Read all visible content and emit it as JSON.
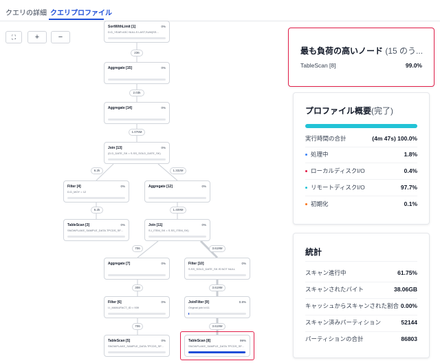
{
  "tabs": [
    {
      "label": "クエリの詳細",
      "active": false
    },
    {
      "label": "クエリプロファイル",
      "active": true
    }
  ],
  "toolbar": {
    "fit_icon": "⛶",
    "zoom_in_icon": "+",
    "zoom_out_icon": "−"
  },
  "graph": {
    "nodes": [
      {
        "title": "SortWithLimit [1]",
        "pct": "0%",
        "detail": "D.D_YEAR ASC NULLS LAST,SUM(SS...",
        "progress": 0
      },
      {
        "title": "Aggregate [15]",
        "pct": "0%",
        "detail": "",
        "progress": 0
      },
      {
        "title": "Aggregate [14]",
        "pct": "0%",
        "detail": "",
        "progress": 0
      },
      {
        "title": "Join [13]",
        "pct": "0%",
        "detail": "(D.D_DATE_SK = S.SS_SOLD_DATE_SK)",
        "progress": 0
      },
      {
        "title": "Filter [4]",
        "pct": "0%",
        "detail": "D.D_MOY = 12",
        "progress": 0
      },
      {
        "title": "Aggregate [12]",
        "pct": "0%",
        "detail": "",
        "progress": 0
      },
      {
        "title": "TableScan [3]",
        "pct": "0%",
        "detail": "SNOWFLAKE_SAMPLE_DATA.TPCDS_SF...",
        "progress": 0
      },
      {
        "title": "Join [11]",
        "pct": "0%",
        "detail": "S.I_ITEM_SK = S.SS_ITEM_SK)",
        "progress": 0
      },
      {
        "title": "Aggregate [7]",
        "pct": "0%",
        "detail": "",
        "progress": 0
      },
      {
        "title": "Filter [10]",
        "pct": "0%",
        "detail": "S.SS_SOLD_DATE_SK IS NOT NULL",
        "progress": 0
      },
      {
        "title": "Filter [6]",
        "pct": "0%",
        "detail": "I.I_MANUFACT_ID = 939",
        "progress": 0
      },
      {
        "title": "JoinFilter [9]",
        "pct": "0.8%",
        "detail": "Original join Id:11",
        "progress": 0.8
      },
      {
        "title": "TableScan [5]",
        "pct": "0%",
        "detail": "SNOWFLAKE_SAMPLE_DATA.TPCDS_SF...",
        "progress": 0
      },
      {
        "title": "TableScan [8]",
        "pct": "99%",
        "detail": "SNOWFLAKE_SAMPLE_DATA.TPCDS_SF...",
        "progress": 99
      }
    ],
    "edges": [
      "236",
      "2.03k",
      "1.076M",
      "6.2k",
      "1.332M",
      "6.2k",
      "1.409M",
      "706",
      "3.619M",
      "308",
      "3.619M",
      "706",
      "3.619M"
    ]
  },
  "heaviest": {
    "title": "最も負荷の高いノード",
    "subtitle": "(15 のう...",
    "item_label": "TableScan [8]",
    "item_value": "99.0%"
  },
  "profile": {
    "title": "プロファイル概要",
    "subtitle": "(完了)",
    "progress": 100,
    "progress_color": "#22c3d6",
    "total_label": "実行時間の合計",
    "total_time": "(4m 47s)",
    "total_pct": "100.0%",
    "rows": [
      {
        "label": "処理中",
        "value": "1.8%",
        "color": "#3b82f6"
      },
      {
        "label": "ローカルディスクI/O",
        "value": "0.4%",
        "color": "#e11d48"
      },
      {
        "label": "リモートディスクI/O",
        "value": "97.7%",
        "color": "#22c3d6"
      },
      {
        "label": "初期化",
        "value": "0.1%",
        "color": "#f97316"
      }
    ]
  },
  "stats": {
    "title": "統計",
    "rows": [
      {
        "label": "スキャン進行中",
        "value": "61.75%"
      },
      {
        "label": "スキャンされたバイト",
        "value": "38.06GB"
      },
      {
        "label": "キャッシュからスキャンされた割合",
        "value": "0.00%"
      },
      {
        "label": "スキャン済みパーティション",
        "value": "52144"
      },
      {
        "label": "パーティションの合計",
        "value": "86803"
      }
    ]
  },
  "colors": {
    "accent": "#1d4ed8",
    "highlight": "#e11d48"
  }
}
